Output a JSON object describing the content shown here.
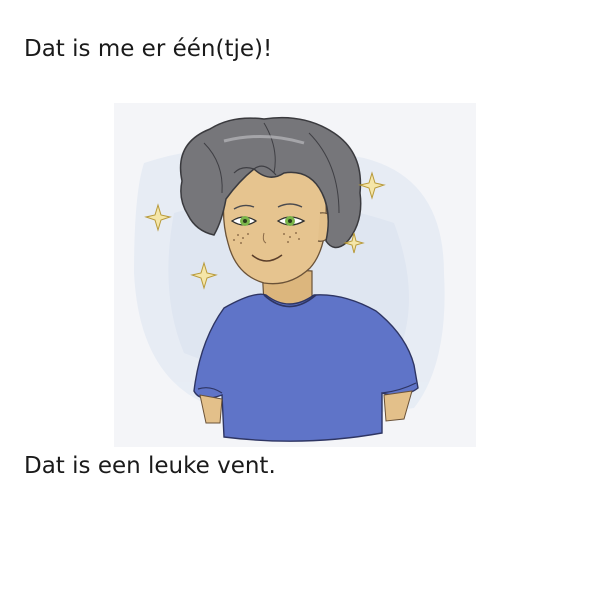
{
  "document": {
    "heading": "Dat is me er één(tje)!",
    "caption": "Dat is een leuke vent."
  },
  "illustration": {
    "subject": "colored-pencil drawing of a boy with gray curly hair, green eyes, freckles and a blue t-shirt",
    "colors": {
      "hair": "#6e6e72",
      "skin": "#e3c08a",
      "eyes": "#7bb54a",
      "shirt": "#5a6fc4",
      "sparkle": "#d8b44a",
      "background": "#d9e2ef"
    }
  }
}
